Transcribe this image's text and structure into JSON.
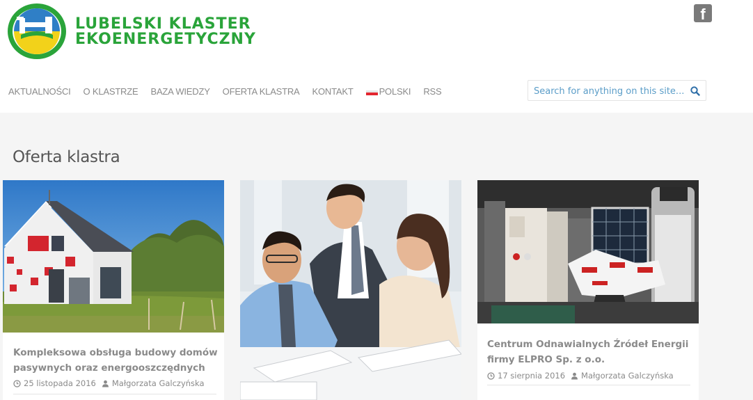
{
  "logo": {
    "line1": "LUBELSKI KLASTER",
    "line2": "EKOENERGETYCZNY"
  },
  "social": {
    "facebook_icon": "facebook-icon",
    "facebook_glyph": "f"
  },
  "nav": {
    "items": [
      {
        "label": "AKTUALNOŚCI"
      },
      {
        "label": "O KLASTRZE"
      },
      {
        "label": "BAZA WIEDZY"
      },
      {
        "label": "OFERTA KLASTRA"
      },
      {
        "label": "KONTAKT"
      },
      {
        "label": "POLSKI",
        "icon": "poland-flag-icon"
      },
      {
        "label": "RSS"
      }
    ]
  },
  "search": {
    "placeholder": "Search for anything on this site...",
    "value": "",
    "icon": "search-icon"
  },
  "page": {
    "title": "Oferta klastra"
  },
  "cards": [
    {
      "image": "house-photo",
      "title_line1": "Kompleksowa obsługa budowy domów",
      "title_line2": "pasywnych oraz energooszczędnych",
      "date": "25 listopada 2016",
      "author": "Małgorzata Galczyńska"
    },
    {
      "image": "business-people-photo"
    },
    {
      "image": "energy-equipment-photo",
      "title_line1": "Centrum Odnawialnych Źródeł Energii",
      "title_line2": "firmy ELPRO Sp. z o.o.",
      "date": "17 sierpnia 2016",
      "author": "Małgorzata Galczyńska"
    }
  ],
  "colors": {
    "brand_green": "#2aa43a",
    "nav_text": "#8a8a8a",
    "link_blue": "#5b9dc8",
    "background": "#f5f5f5"
  }
}
